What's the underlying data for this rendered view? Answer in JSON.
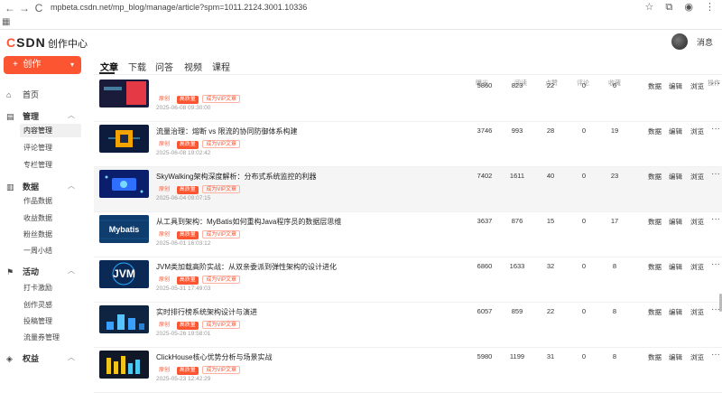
{
  "browser": {
    "url": "mpbeta.csdn.net/mp_blog/manage/article?spm=1011.2124.3001.10336",
    "back": "←",
    "forward": "→",
    "reload": "C",
    "icons": [
      "star-icon",
      "extensions-icon",
      "account-icon",
      "menu-icon"
    ]
  },
  "header": {
    "logo": "CSDN",
    "title": "创作中心",
    "messages": "消息"
  },
  "sidebar": {
    "create": "创作",
    "home": "首页",
    "manage": {
      "label": "管理",
      "items": [
        "内容管理",
        "评论管理",
        "专栏管理"
      ]
    },
    "data": {
      "label": "数据",
      "items": [
        "作品数据",
        "收益数据",
        "粉丝数据",
        "一周小结"
      ]
    },
    "activity": {
      "label": "活动",
      "items": [
        "打卡激励",
        "创作灵感",
        "投稿管理",
        "流量券管理"
      ]
    },
    "rights": {
      "label": "权益"
    }
  },
  "tabs": [
    "文章",
    "下载",
    "问答",
    "视频",
    "课程"
  ],
  "table": {
    "headers": {
      "article": "文章",
      "exposure": "曝光",
      "read": "阅读",
      "like": "点赞",
      "comment": "评论",
      "fav": "收藏",
      "ops": "操作"
    },
    "tag_labels": {
      "orig": "原创",
      "hq": "高质量",
      "vip": "成为VIP文章"
    },
    "actions": {
      "data": "数据",
      "edit": "编辑",
      "browse": "浏览",
      "more": "···"
    },
    "rows": [
      {
        "title": "",
        "date": "2025-06-08 09:30:00",
        "exposure": "5860",
        "read": "823",
        "like": "22",
        "comment": "0",
        "fav": "6",
        "thumb": "red"
      },
      {
        "title": "流量治理：熔断 vs 限流的协同防御体系构建",
        "date": "2025-06-08 19:02:42",
        "exposure": "3746",
        "read": "993",
        "like": "28",
        "comment": "0",
        "fav": "19",
        "thumb": "chip"
      },
      {
        "title": "SkyWalking架构深度解析：分布式系统监控的利器",
        "date": "2025-06-04 09:07:15",
        "exposure": "7402",
        "read": "1611",
        "like": "40",
        "comment": "0",
        "fav": "23",
        "thumb": "blue"
      },
      {
        "title": "从工具到架构：MyBatis如何重构Java程序员的数据层思维",
        "date": "2025-06-01 16:03:12",
        "exposure": "3637",
        "read": "876",
        "like": "15",
        "comment": "0",
        "fav": "17",
        "thumb": "mybatis",
        "thumb_text": "Mybatis"
      },
      {
        "title": "JVM类加载高阶实战：从双亲委派到弹性架构的设计进化",
        "date": "2025-05-31 17:49:03",
        "exposure": "6860",
        "read": "1633",
        "like": "32",
        "comment": "0",
        "fav": "8",
        "thumb": "jvm",
        "thumb_text": "JVM"
      },
      {
        "title": "实时排行榜系统架构设计与演进",
        "date": "2025-05-26 19:58:01",
        "exposure": "6057",
        "read": "859",
        "like": "22",
        "comment": "0",
        "fav": "8",
        "thumb": "rank"
      },
      {
        "title": "ClickHouse核心优势分析与场景实战",
        "date": "2025-05-23 12:42:29",
        "exposure": "5980",
        "read": "1199",
        "like": "31",
        "comment": "0",
        "fav": "8",
        "thumb": "click"
      }
    ]
  }
}
